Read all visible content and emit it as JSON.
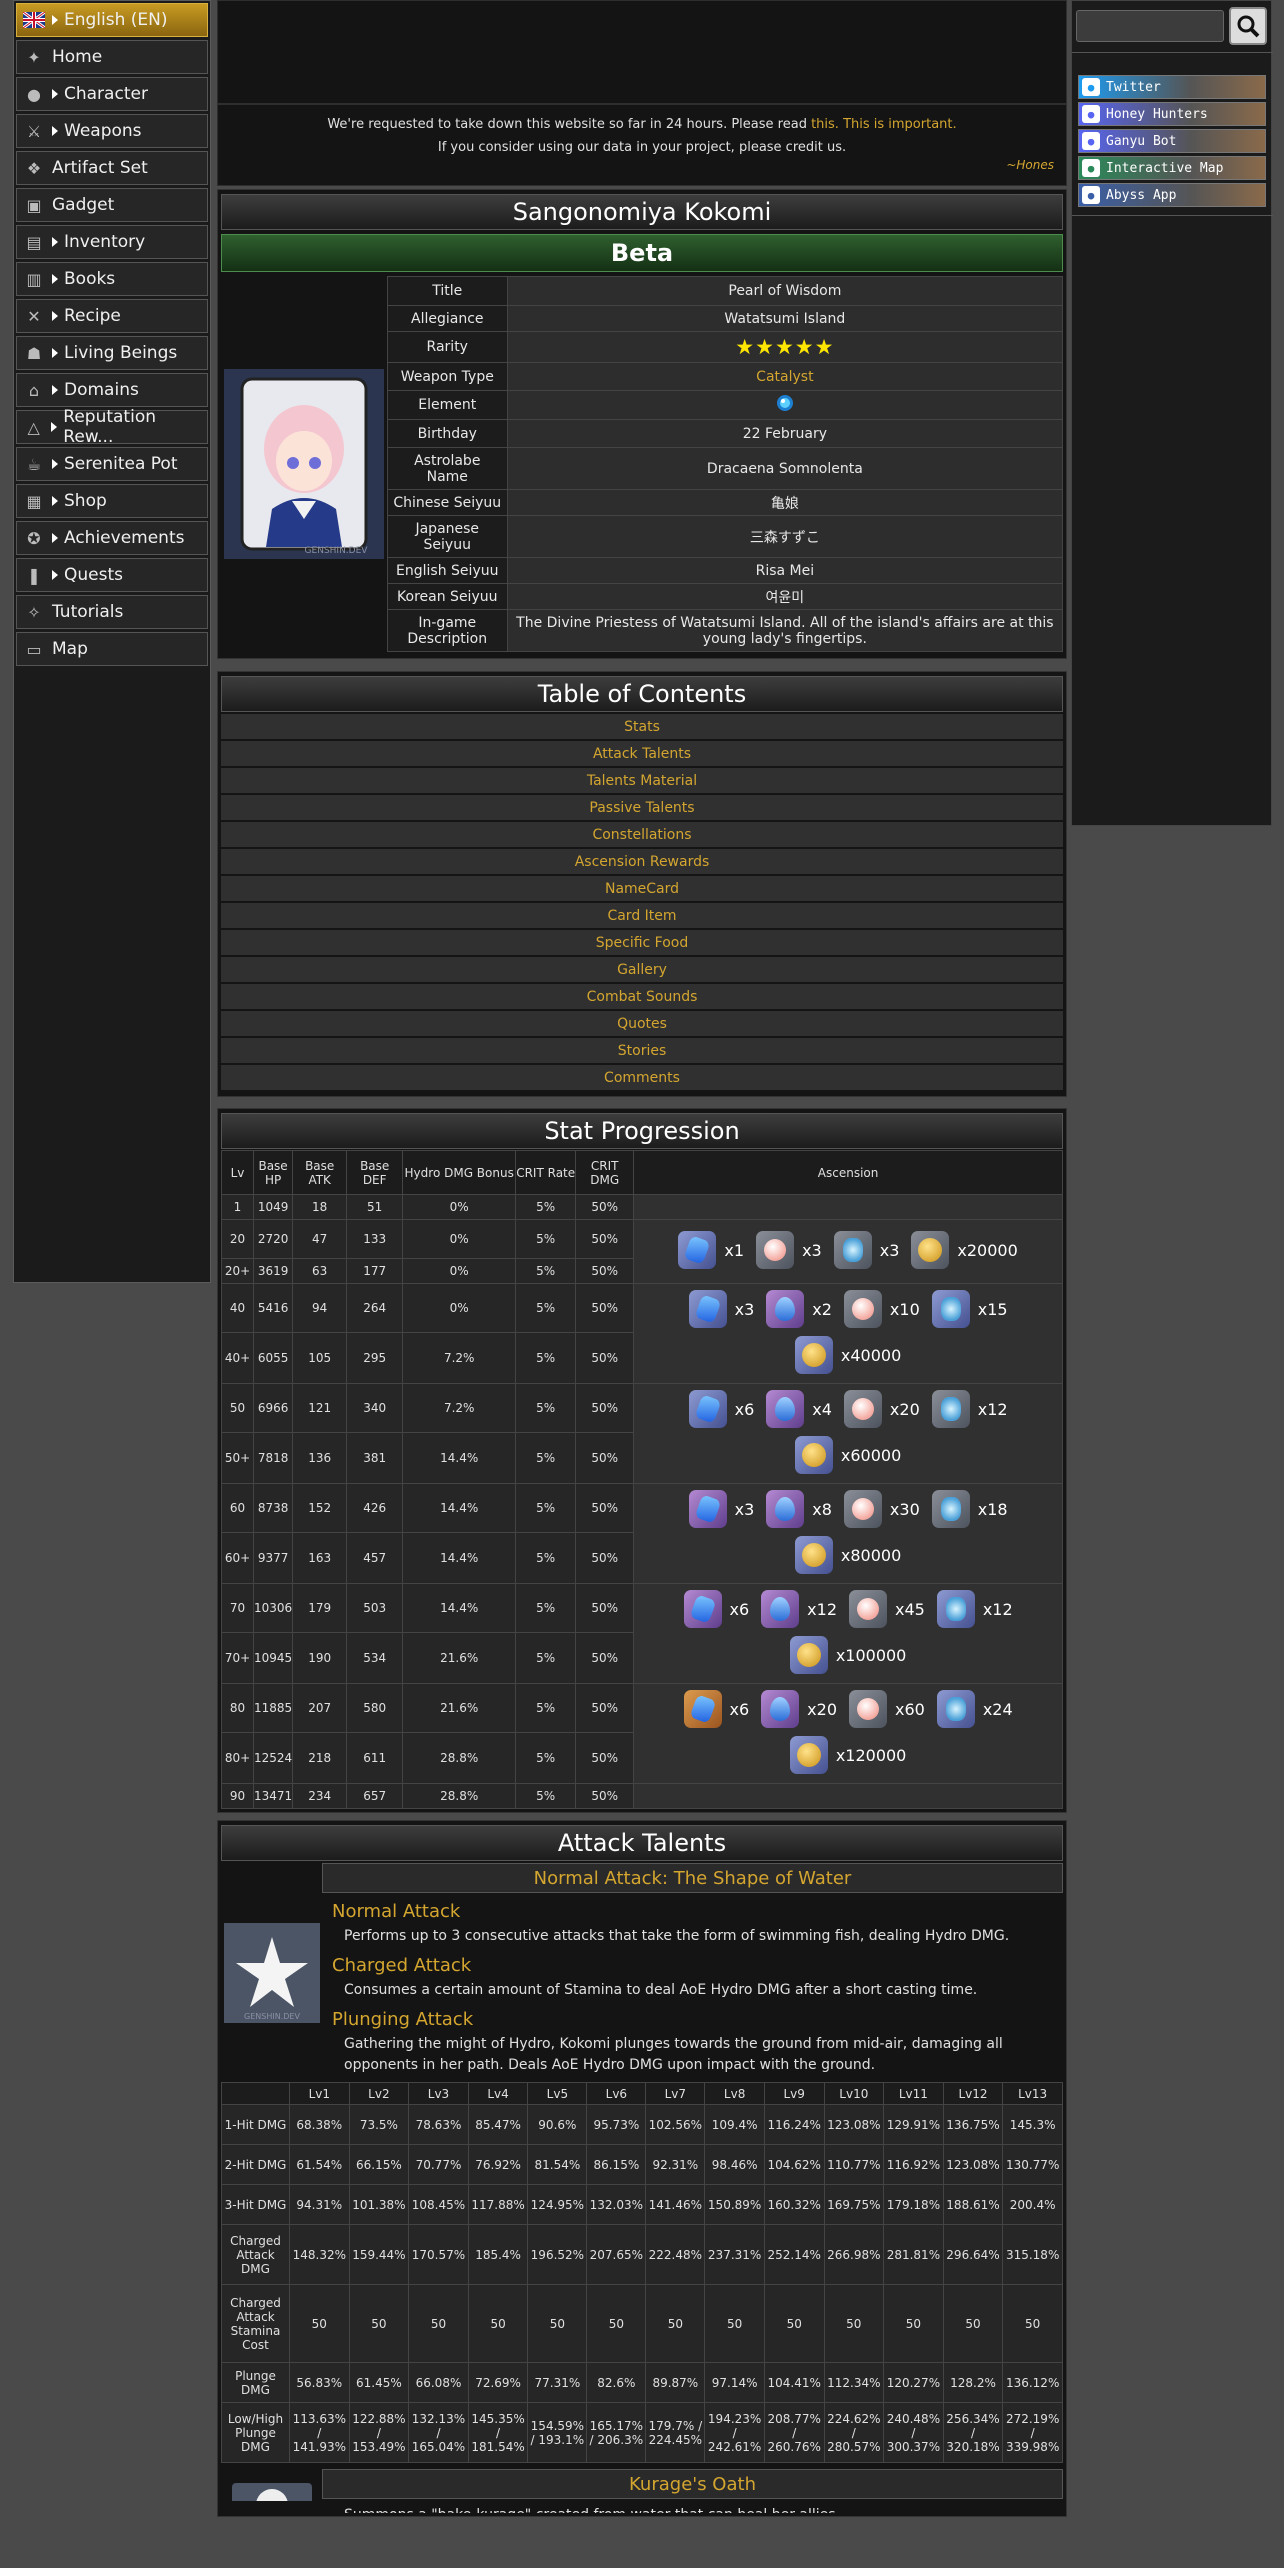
{
  "sidebar": {
    "items": [
      {
        "label": "English (EN)",
        "icon": "uk-flag-icon",
        "arrow": true,
        "active": true
      },
      {
        "label": "Home",
        "icon": "star-icon",
        "arrow": false
      },
      {
        "label": "Character",
        "icon": "character-icon",
        "arrow": true
      },
      {
        "label": "Weapons",
        "icon": "sword-icon",
        "arrow": true
      },
      {
        "label": "Artifact Set",
        "icon": "artifact-icon",
        "arrow": false
      },
      {
        "label": "Gadget",
        "icon": "gadget-icon",
        "arrow": false
      },
      {
        "label": "Inventory",
        "icon": "bag-icon",
        "arrow": true
      },
      {
        "label": "Books",
        "icon": "book-icon",
        "arrow": true
      },
      {
        "label": "Recipe",
        "icon": "fork-knife-icon",
        "arrow": true
      },
      {
        "label": "Living Beings",
        "icon": "monster-icon",
        "arrow": true
      },
      {
        "label": "Domains",
        "icon": "domain-icon",
        "arrow": true
      },
      {
        "label": "Reputation Rew...",
        "icon": "reputation-icon",
        "arrow": true
      },
      {
        "label": "Serenitea Pot",
        "icon": "teapot-icon",
        "arrow": true
      },
      {
        "label": "Shop",
        "icon": "shop-icon",
        "arrow": true
      },
      {
        "label": "Achievements",
        "icon": "achievement-icon",
        "arrow": true
      },
      {
        "label": "Quests",
        "icon": "quest-icon",
        "arrow": true
      },
      {
        "label": "Tutorials",
        "icon": "tutorial-icon",
        "arrow": false
      },
      {
        "label": "Map",
        "icon": "map-icon",
        "arrow": false
      }
    ]
  },
  "notice": {
    "line1": "We're requested to take down this website so far in 24 hours. Please read ",
    "link": "this. This is important.",
    "line2": "If you consider using our data in your project, please credit us.",
    "signature": "~Hones"
  },
  "character": {
    "name": "Sangonomiya Kokomi",
    "badge": "Beta",
    "watermark": "GENSHIN.DEV",
    "info": [
      {
        "k": "Title",
        "v": "Pearl of Wisdom"
      },
      {
        "k": "Allegiance",
        "v": "Watatsumi Island"
      },
      {
        "k": "Rarity",
        "v": "★★★★★",
        "stars": true
      },
      {
        "k": "Weapon Type",
        "v": "Catalyst",
        "gold": true
      },
      {
        "k": "Element",
        "v": "",
        "element": true
      },
      {
        "k": "Birthday",
        "v": "22 February"
      },
      {
        "k": "Astrolabe Name",
        "v": "Dracaena Somnolenta"
      },
      {
        "k": "Chinese Seiyuu",
        "v": "亀娘"
      },
      {
        "k": "Japanese Seiyuu",
        "v": "三森すずこ"
      },
      {
        "k": "English Seiyuu",
        "v": "Risa Mei"
      },
      {
        "k": "Korean Seiyuu",
        "v": "여윤미"
      },
      {
        "k": "In-game Description",
        "v": "The Divine Priestess of Watatsumi Island. All of the island's affairs are at this young lady's fingertips."
      }
    ]
  },
  "toc": {
    "title": "Table of Contents",
    "items": [
      "Stats",
      "Attack Talents",
      "Talents Material",
      "Passive Talents",
      "Constellations",
      "Ascension Rewards",
      "NameCard",
      "Card Item",
      "Specific Food",
      "Gallery",
      "Combat Sounds",
      "Quotes",
      "Stories",
      "Comments"
    ]
  },
  "stats": {
    "title": "Stat Progression",
    "headers": [
      "Lv",
      "Base HP",
      "Base ATK",
      "Base DEF",
      "Hydro DMG Bonus",
      "CRIT Rate",
      "CRIT DMG",
      "Ascension"
    ],
    "rows": [
      [
        "1",
        "1049",
        "18",
        "51",
        "0%",
        "5%",
        "50%"
      ],
      [
        "20",
        "2720",
        "47",
        "133",
        "0%",
        "5%",
        "50%"
      ],
      [
        "20+",
        "3619",
        "63",
        "177",
        "0%",
        "5%",
        "50%"
      ],
      [
        "40",
        "5416",
        "94",
        "264",
        "0%",
        "5%",
        "50%"
      ],
      [
        "40+",
        "6055",
        "105",
        "295",
        "7.2%",
        "5%",
        "50%"
      ],
      [
        "50",
        "6966",
        "121",
        "340",
        "7.2%",
        "5%",
        "50%"
      ],
      [
        "50+",
        "7818",
        "136",
        "381",
        "14.4%",
        "5%",
        "50%"
      ],
      [
        "60",
        "8738",
        "152",
        "426",
        "14.4%",
        "5%",
        "50%"
      ],
      [
        "60+",
        "9377",
        "163",
        "457",
        "14.4%",
        "5%",
        "50%"
      ],
      [
        "70",
        "10306",
        "179",
        "503",
        "14.4%",
        "5%",
        "50%"
      ],
      [
        "70+",
        "10945",
        "190",
        "534",
        "21.6%",
        "5%",
        "50%"
      ],
      [
        "80",
        "11885",
        "207",
        "580",
        "21.6%",
        "5%",
        "50%"
      ],
      [
        "80+",
        "12524",
        "218",
        "611",
        "28.8%",
        "5%",
        "50%"
      ],
      [
        "90",
        "13471",
        "234",
        "657",
        "28.8%",
        "5%",
        "50%"
      ]
    ],
    "ascensions": [
      {
        "lines": [
          [
            {
              "c": "blue",
              "g": "gem",
              "q": "x1"
            },
            {
              "c": "gray",
              "g": "pearl",
              "q": "x3"
            },
            {
              "c": "gray",
              "g": "spec",
              "q": "x3"
            },
            {
              "c": "gray",
              "g": "coin",
              "q": "x20000"
            }
          ]
        ]
      },
      {
        "lines": [
          [
            {
              "c": "blue",
              "g": "gem",
              "q": "x3"
            },
            {
              "c": "purple",
              "g": "drop",
              "q": "x2"
            },
            {
              "c": "gray",
              "g": "pearl",
              "q": "x10"
            },
            {
              "c": "blue",
              "g": "spec",
              "q": "x15"
            }
          ],
          [
            {
              "c": "blue",
              "g": "coin",
              "q": "x40000"
            }
          ]
        ]
      },
      {
        "lines": [
          [
            {
              "c": "blue",
              "g": "gem",
              "q": "x6"
            },
            {
              "c": "purple",
              "g": "drop",
              "q": "x4"
            },
            {
              "c": "gray",
              "g": "pearl",
              "q": "x20"
            },
            {
              "c": "gray",
              "g": "spec",
              "q": "x12"
            }
          ],
          [
            {
              "c": "blue",
              "g": "coin",
              "q": "x60000"
            }
          ]
        ]
      },
      {
        "lines": [
          [
            {
              "c": "purple",
              "g": "gem",
              "q": "x3"
            },
            {
              "c": "purple",
              "g": "drop",
              "q": "x8"
            },
            {
              "c": "gray",
              "g": "pearl",
              "q": "x30"
            },
            {
              "c": "gray",
              "g": "spec",
              "q": "x18"
            }
          ],
          [
            {
              "c": "blue",
              "g": "coin",
              "q": "x80000"
            }
          ]
        ]
      },
      {
        "lines": [
          [
            {
              "c": "purple",
              "g": "gem",
              "q": "x6"
            },
            {
              "c": "purple",
              "g": "drop",
              "q": "x12"
            },
            {
              "c": "gray",
              "g": "pearl",
              "q": "x45"
            },
            {
              "c": "blue",
              "g": "spec",
              "q": "x12"
            }
          ],
          [
            {
              "c": "blue",
              "g": "coin",
              "q": "x100000"
            }
          ]
        ]
      },
      {
        "lines": [
          [
            {
              "c": "orange",
              "g": "gem",
              "q": "x6"
            },
            {
              "c": "purple",
              "g": "drop",
              "q": "x20"
            },
            {
              "c": "gray",
              "g": "pearl",
              "q": "x60"
            },
            {
              "c": "blue",
              "g": "spec",
              "q": "x24"
            }
          ],
          [
            {
              "c": "blue",
              "g": "coin",
              "q": "x120000"
            }
          ]
        ]
      }
    ]
  },
  "talents": {
    "title": "Attack Talents",
    "talent1": {
      "header": "Normal Attack: The Shape of Water",
      "watermark": "GENSHIN.DEV",
      "sections": [
        {
          "name": "Normal Attack",
          "desc": "Performs up to 3 consecutive attacks that take the form of swimming fish, dealing Hydro DMG."
        },
        {
          "name": "Charged Attack",
          "desc": "Consumes a certain amount of Stamina to deal AoE Hydro DMG after a short casting time."
        },
        {
          "name": "Plunging Attack",
          "desc": "Gathering the might of Hydro, Kokomi plunges towards the ground from mid-air, damaging all opponents in her path. Deals AoE Hydro DMG upon impact with the ground."
        }
      ],
      "levels": [
        "",
        "Lv1",
        "Lv2",
        "Lv3",
        "Lv4",
        "Lv5",
        "Lv6",
        "Lv7",
        "Lv8",
        "Lv9",
        "Lv10",
        "Lv11",
        "Lv12",
        "Lv13"
      ],
      "rows": [
        [
          "1-Hit DMG",
          "68.38%",
          "73.5%",
          "78.63%",
          "85.47%",
          "90.6%",
          "95.73%",
          "102.56%",
          "109.4%",
          "116.24%",
          "123.08%",
          "129.91%",
          "136.75%",
          "145.3%"
        ],
        [
          "2-Hit DMG",
          "61.54%",
          "66.15%",
          "70.77%",
          "76.92%",
          "81.54%",
          "86.15%",
          "92.31%",
          "98.46%",
          "104.62%",
          "110.77%",
          "116.92%",
          "123.08%",
          "130.77%"
        ],
        [
          "3-Hit DMG",
          "94.31%",
          "101.38%",
          "108.45%",
          "117.88%",
          "124.95%",
          "132.03%",
          "141.46%",
          "150.89%",
          "160.32%",
          "169.75%",
          "179.18%",
          "188.61%",
          "200.4%"
        ],
        [
          "Charged Attack DMG",
          "148.32%",
          "159.44%",
          "170.57%",
          "185.4%",
          "196.52%",
          "207.65%",
          "222.48%",
          "237.31%",
          "252.14%",
          "266.98%",
          "281.81%",
          "296.64%",
          "315.18%"
        ],
        [
          "Charged Attack Stamina Cost",
          "50",
          "50",
          "50",
          "50",
          "50",
          "50",
          "50",
          "50",
          "50",
          "50",
          "50",
          "50",
          "50"
        ],
        [
          "Plunge DMG",
          "56.83%",
          "61.45%",
          "66.08%",
          "72.69%",
          "77.31%",
          "82.6%",
          "89.87%",
          "97.14%",
          "104.41%",
          "112.34%",
          "120.27%",
          "128.2%",
          "136.12%"
        ],
        [
          "Low/High Plunge DMG",
          "113.63% / 141.93%",
          "122.88% / 153.49%",
          "132.13% / 165.04%",
          "145.35% / 181.54%",
          "154.59% / 193.1%",
          "165.17% / 206.3%",
          "179.7% / 224.45%",
          "194.23% / 242.61%",
          "208.77% / 260.76%",
          "224.62% / 280.57%",
          "240.48% / 300.37%",
          "256.34% / 320.18%",
          "272.19% / 339.98%"
        ]
      ]
    },
    "talent2": {
      "header": "Kurage's Oath",
      "desc": "Summons a \"bake-kurage\" created from water that can heal her allies."
    }
  },
  "right": {
    "search_placeholder": "",
    "socials": [
      {
        "label": "Twitter",
        "icon": "twitter-icon",
        "color": "#1d9bf0"
      },
      {
        "label": "Honey Hunters",
        "icon": "discord-icon",
        "color": "#5865f2"
      },
      {
        "label": "Ganyu Bot",
        "icon": "discord-icon",
        "color": "#5865f2"
      },
      {
        "label": "Interactive Map",
        "icon": "map-pin-icon",
        "color": "#2a8a5a"
      },
      {
        "label": "Abyss App",
        "icon": "abyss-icon",
        "color": "#3a5fa8"
      }
    ]
  }
}
